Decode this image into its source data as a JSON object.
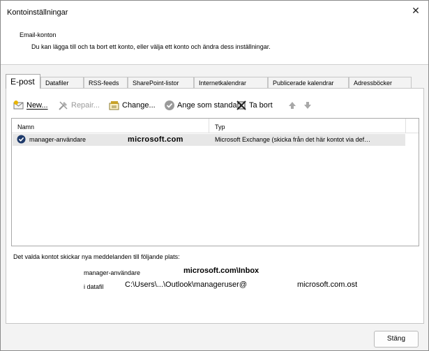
{
  "window": {
    "title": "Kontoinställningar",
    "close_glyph": "✕"
  },
  "header": {
    "title": "Email-konton",
    "description": "Du kan lägga till och ta bort ett konto, eller välja ett konto och ändra dess inställningar."
  },
  "tabs": [
    {
      "label": "E-post",
      "active": true
    },
    {
      "label": "Datafiler"
    },
    {
      "label": "RSS-feeds"
    },
    {
      "label": "SharePoint-listor"
    },
    {
      "label": "Internetkalendrar"
    },
    {
      "label": "Publicerade kalendrar"
    },
    {
      "label": "Adressböcker"
    }
  ],
  "toolbar": {
    "new_label": "New...",
    "repair_label": "Repair...",
    "change_label": "Change...",
    "default_label": "Ange som standard",
    "remove_label": "Ta bort",
    "up_icon": "arrow-up-icon",
    "down_icon": "arrow-down-icon"
  },
  "list": {
    "columns": [
      "Namn",
      "Typ"
    ],
    "rows": [
      {
        "name": "manager-användare",
        "domain": "microsoft.com",
        "type": "Microsoft Exchange (skicka från det här kontot via def…"
      }
    ]
  },
  "delivery": {
    "intro": "Det valda kontot skickar nya meddelanden till följande plats:",
    "account_name": "manager-användare",
    "inbox": "microsoft.com\\Inbox",
    "datafile_label": "i datafil",
    "datafile_path": "C:\\Users\\...\\Outlook\\manageruser@",
    "datafile_domain": "microsoft.com.ost"
  },
  "footer": {
    "close_label": "Stäng"
  },
  "colors": {
    "accent": "#0b57d0",
    "selected_row": "#e7e7e7"
  }
}
